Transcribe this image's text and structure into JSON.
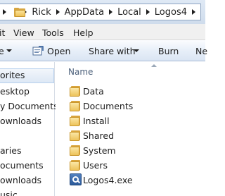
{
  "address": {
    "crumbs": [
      "Rick",
      "AppData",
      "Local",
      "Logos4"
    ]
  },
  "menu": {
    "items": [
      "it",
      "View",
      "Tools",
      "Help"
    ]
  },
  "toolbar": {
    "organize_label": "e",
    "open_label": "Open",
    "share_label": "Share with",
    "burn_label": "Burn",
    "new_label": "Ne"
  },
  "nav": {
    "items": [
      "orites",
      "esktop",
      "y Documents",
      "ownloads",
      "aries",
      "ocuments",
      "ownloads",
      "usic"
    ]
  },
  "content": {
    "column_name": "Name",
    "folders": [
      "Data",
      "Documents",
      "Install",
      "Shared",
      "System",
      "Users"
    ],
    "file": "Logos4.exe"
  },
  "colors": {
    "folder_yellow": "#edc35b",
    "toolbar_blue": "#dae5f3",
    "selection_border": "#b8d1ee"
  },
  "icons": [
    "folder-icon",
    "open-icon",
    "exe-icon",
    "chevron-down-icon",
    "breadcrumb-arrow-icon"
  ]
}
